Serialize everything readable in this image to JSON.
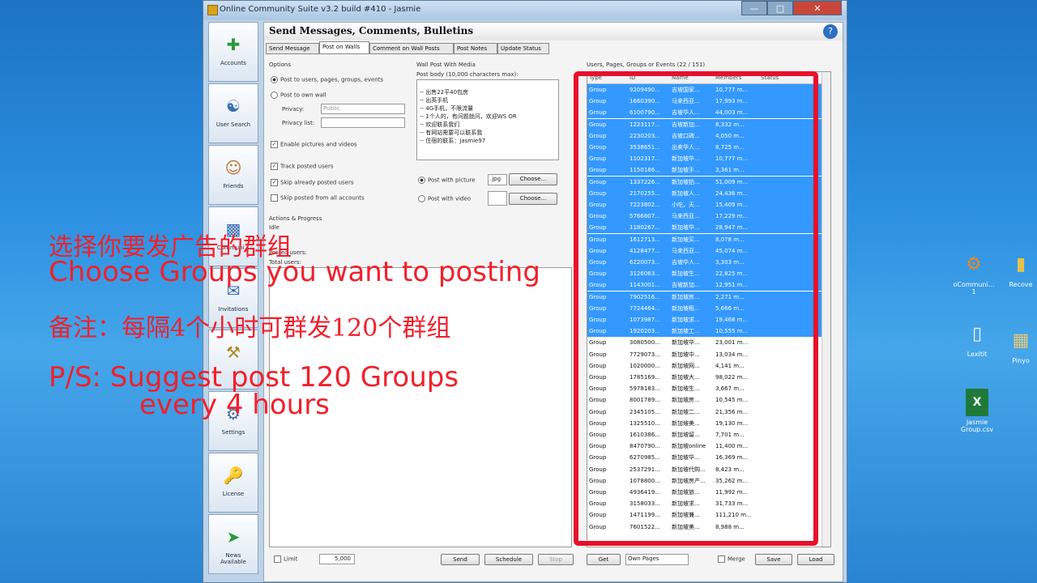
{
  "window": {
    "title": "Online Community Suite v3.2 build #410 - Jasmie"
  },
  "sidebar": {
    "items": [
      {
        "label": "Accounts",
        "icon": "accounts-icon"
      },
      {
        "label": "User Search",
        "icon": "user-search-icon"
      },
      {
        "label": "Friends",
        "icon": "friends-icon"
      },
      {
        "label": "Communi...",
        "icon": "community-icon"
      },
      {
        "label": "Invitations",
        "icon": "invitations-icon"
      },
      {
        "label": "",
        "icon": "tools-icon"
      },
      {
        "label": "Settings",
        "icon": "settings-icon"
      },
      {
        "label": "License",
        "icon": "license-icon"
      },
      {
        "label": "News\nAvailable",
        "icon": "news-icon"
      }
    ]
  },
  "header": {
    "title": "Send Messages, Comments, Bulletins"
  },
  "tabs": [
    "Send Message",
    "Post on Walls",
    "Comment on Wall Posts",
    "Post Notes",
    "Update Status"
  ],
  "options": {
    "title": "Options",
    "radio1": "Post to users, pages, groups, events",
    "radio2": "Post to own wall",
    "privacy_label": "Privacy:",
    "privacy_value": "Public",
    "privacy_list_label": "Privacy list:",
    "cb_enable": "Enable pictures and videos",
    "cb_track": "Track posted users",
    "cb_skip": "Skip already posted users",
    "cb_skip_all": "Skip posted from all accounts"
  },
  "wallpost": {
    "title": "Wall Post With Media",
    "body_label": "Post body (10,000 characters max):",
    "lines": [
      "-- 出售22平40包房",
      "-- 出英手机",
      "-- 4G手机，不限流量",
      "-- 1个人的，有问题就问，欢迎WS OR",
      "-- 欢迎联系我们",
      "-- 有网站需要可以联系我",
      "-- 住宿的联系：Jasmie97"
    ],
    "with_picture": "Post with picture",
    "picture_value": ".jpg",
    "with_video": "Post with video",
    "choose": "Choose..."
  },
  "progress": {
    "title": "Actions & Progress",
    "idle": "Idle",
    "posted": "Posted users:",
    "total": "Total users:"
  },
  "groups": {
    "title": "Users, Pages, Groups or Events (22 / 151)",
    "columns": [
      "Type",
      "ID",
      "Name",
      "Members",
      "Status"
    ],
    "rows": [
      {
        "t": "Group",
        "id": "9209490...",
        "n": "吉坡国家...",
        "m": "10,777 m..."
      },
      {
        "t": "Group",
        "id": "1660390...",
        "n": "马来西亚...",
        "m": "17,993 m..."
      },
      {
        "t": "Group",
        "id": "6100790...",
        "n": "吉坡华人...",
        "m": "44,003 m..."
      },
      {
        "t": "Group",
        "id": "1223117...",
        "n": "吉坡新加...",
        "m": "8,332 m..."
      },
      {
        "t": "Group",
        "id": "2230203...",
        "n": "吉坡口碑...",
        "m": "4,050 m..."
      },
      {
        "t": "Group",
        "id": "3538651...",
        "n": "出卖华人...",
        "m": "8,725 m..."
      },
      {
        "t": "Group",
        "id": "1102317...",
        "n": "新加坡华...",
        "m": "10,777 m..."
      },
      {
        "t": "Group",
        "id": "1150186...",
        "n": "新加坡手...",
        "m": "3,361 m..."
      },
      {
        "t": "Group",
        "id": "1337226...",
        "n": "新加坡拍...",
        "m": "51,009 m..."
      },
      {
        "t": "Group",
        "id": "2170255...",
        "n": "新加坡人...",
        "m": "24,436 m..."
      },
      {
        "t": "Group",
        "id": "7223802...",
        "n": "小吃，天...",
        "m": "15,409 m..."
      },
      {
        "t": "Group",
        "id": "5766807...",
        "n": "马来西亚...",
        "m": "17,229 m..."
      },
      {
        "t": "Group",
        "id": "1180267...",
        "n": "新加坡华...",
        "m": "28,947 m..."
      },
      {
        "t": "Group",
        "id": "1612713...",
        "n": "新加坡买...",
        "m": "8,078 m..."
      },
      {
        "t": "Group",
        "id": "4128477...",
        "n": "马来西亚...",
        "m": "45,074 m..."
      },
      {
        "t": "Group",
        "id": "6220073...",
        "n": "吉坡华人...",
        "m": "3,303 m..."
      },
      {
        "t": "Group",
        "id": "3126063...",
        "n": "新加坡生...",
        "m": "22,825 m..."
      },
      {
        "t": "Group",
        "id": "1143001...",
        "n": "吉坡新加...",
        "m": "12,951 m..."
      },
      {
        "t": "Group",
        "id": "7902516...",
        "n": "新加坡房...",
        "m": "2,271 m..."
      },
      {
        "t": "Group",
        "id": "7724464...",
        "n": "新加坡租...",
        "m": "5,666 m..."
      },
      {
        "t": "Group",
        "id": "1073987...",
        "n": "新加坡求...",
        "m": "19,468 m..."
      },
      {
        "t": "Group",
        "id": "1920203...",
        "n": "新加坡工...",
        "m": "10,555 m..."
      },
      {
        "t": "Group",
        "id": "3080500...",
        "n": "新加坡华...",
        "m": "23,001 m..."
      },
      {
        "t": "Group",
        "id": "7729073...",
        "n": "新加坡中...",
        "m": "13,034 m..."
      },
      {
        "t": "Group",
        "id": "1020000...",
        "n": "新加坡网...",
        "m": "4,141 m..."
      },
      {
        "t": "Group",
        "id": "1785169...",
        "n": "新加坡大...",
        "m": "98,022 m..."
      },
      {
        "t": "Group",
        "id": "5978183...",
        "n": "新加坡生...",
        "m": "3,667 m..."
      },
      {
        "t": "Group",
        "id": "8001789...",
        "n": "新加坡房...",
        "m": "10,545 m..."
      },
      {
        "t": "Group",
        "id": "2345105...",
        "n": "新加坡二...",
        "m": "21,356 m..."
      },
      {
        "t": "Group",
        "id": "1325510...",
        "n": "新加坡美...",
        "m": "19,130 m..."
      },
      {
        "t": "Group",
        "id": "1610386...",
        "n": "新加坡留...",
        "m": "7,701 m..."
      },
      {
        "t": "Group",
        "id": "8470790...",
        "n": "新加坡online",
        "m": "11,400 m..."
      },
      {
        "t": "Group",
        "id": "6270985...",
        "n": "新加坡华...",
        "m": "16,369 m..."
      },
      {
        "t": "Group",
        "id": "2537291...",
        "n": "新加坡代购...",
        "m": "8,423 m..."
      },
      {
        "t": "Group",
        "id": "1078800...",
        "n": "新加坡房产...",
        "m": "35,262 m..."
      },
      {
        "t": "Group",
        "id": "4936419...",
        "n": "新加坡旅...",
        "m": "11,992 m..."
      },
      {
        "t": "Group",
        "id": "3158033...",
        "n": "新加坡求...",
        "m": "31,733 m..."
      },
      {
        "t": "Group",
        "id": "1471199...",
        "n": "新加坡兼...",
        "m": "111,210 m..."
      },
      {
        "t": "Group",
        "id": "7601522...",
        "n": "新加坡美...",
        "m": "8,988 m..."
      }
    ]
  },
  "bottom": {
    "limit_label": "Limit",
    "limit_value": "5,000",
    "send": "Send",
    "schedule": "Schedule",
    "stop": "Stop",
    "get": "Get",
    "own_pages": "Own Pages",
    "merge": "Merge",
    "save": "Save",
    "load": "Load"
  },
  "overlay": {
    "line1": "选择你要发广告的群组",
    "line2": "Choose Groups you want to posting",
    "line3": "备注：每隔4个小时可群发120个群组",
    "line4": "P/S: Suggest post 120 Groups",
    "line5": "every 4 hours"
  },
  "desktop": {
    "icons": [
      {
        "label": "oCommuni...\n1",
        "icon": "app-icon"
      },
      {
        "label": "Recove",
        "icon": "folder-icon"
      },
      {
        "label": "Lexitit",
        "icon": "document-icon"
      },
      {
        "label": "Pinyo",
        "icon": "image-icon"
      },
      {
        "label": "Jasmie\nGroup.csv",
        "icon": "excel-icon"
      }
    ]
  },
  "colors": {
    "selection": "#3399ff",
    "highlight": "#e8102a",
    "overlay_text": "#f0202c"
  }
}
